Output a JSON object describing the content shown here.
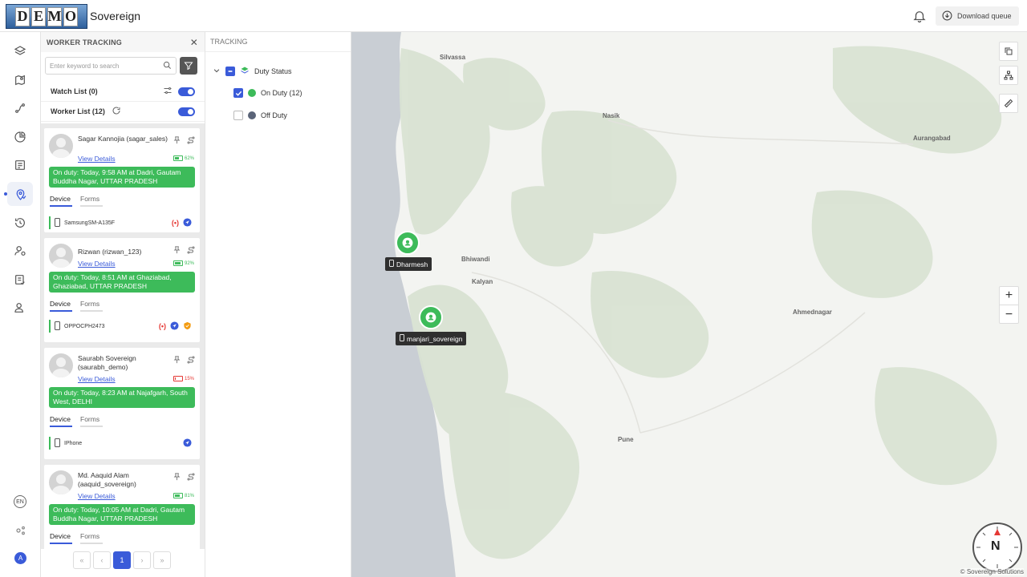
{
  "app": {
    "logo_letters": [
      "D",
      "E",
      "M",
      "O"
    ],
    "name": "Sovereign",
    "download_label": "Download queue"
  },
  "rail": {
    "lang": "EN",
    "avatar_initial": "A"
  },
  "worker_panel": {
    "title": "WORKER TRACKING",
    "search_placeholder": "Enter keyword to search",
    "watch_list_label": "Watch List (0)",
    "worker_list_label": "Worker List (12)",
    "workers": [
      {
        "name": "Sagar Kannojia (sagar_sales)",
        "view_details": "View Details",
        "battery": "62%",
        "battery_level": 0.62,
        "battery_color": "#3dbb5a",
        "duty_text": "On duty: Today, 9:58 AM at Dadri, Gautam Buddha Nagar, UTTAR PRADESH",
        "tab_device": "Device",
        "tab_forms": "Forms",
        "device": "SamsungSM-A135F"
      },
      {
        "name": "Rizwan (rizwan_123)",
        "view_details": "View Details",
        "battery": "92%",
        "battery_level": 0.92,
        "battery_color": "#3dbb5a",
        "duty_text": "On duty: Today, 8:51 AM at Ghaziabad, Ghaziabad, UTTAR PRADESH",
        "tab_device": "Device",
        "tab_forms": "Forms",
        "device": "OPPOCPH2473"
      },
      {
        "name": "Saurabh Sovereign (saurabh_demo)",
        "view_details": "View Details",
        "battery": "15%",
        "battery_level": 0.15,
        "battery_color": "#e53935",
        "duty_text": "On duty: Today, 8:23 AM at Najafgarh, South West, DELHI",
        "tab_device": "Device",
        "tab_forms": "Forms",
        "device": "IPhone"
      },
      {
        "name": "Md. Aaquid Alam (aaquid_sovereign)",
        "view_details": "View Details",
        "battery": "81%",
        "battery_level": 0.81,
        "battery_color": "#3dbb5a",
        "duty_text": "On duty: Today, 10:05 AM at Dadri, Gautam Buddha Nagar, UTTAR PRADESH",
        "tab_device": "Device",
        "tab_forms": "Forms"
      }
    ],
    "pager": {
      "first": "«",
      "prev": "‹",
      "current": "1",
      "next": "›",
      "last": "»"
    }
  },
  "tracking_panel": {
    "title": "TRACKING",
    "root_label": "Duty Status",
    "on_duty_label": "On Duty (12)",
    "off_duty_label": "Off Duty",
    "on_duty_color": "#3dbb5a",
    "off_duty_color": "#5a6478"
  },
  "map": {
    "cities": [
      "Silvassa",
      "Nasik",
      "Aurangabad",
      "Bhiwandi",
      "Kalyan",
      "Ahmednagar",
      "Pune"
    ],
    "markers": [
      "Dharmesh",
      "manjari_sovereign"
    ],
    "zoom_in": "+",
    "zoom_out": "−",
    "compass_letter": "N",
    "attribution": "© Sovereign Solutions"
  },
  "colors": {
    "accent": "#3a5bd9",
    "duty_green": "#3dbb5a"
  }
}
